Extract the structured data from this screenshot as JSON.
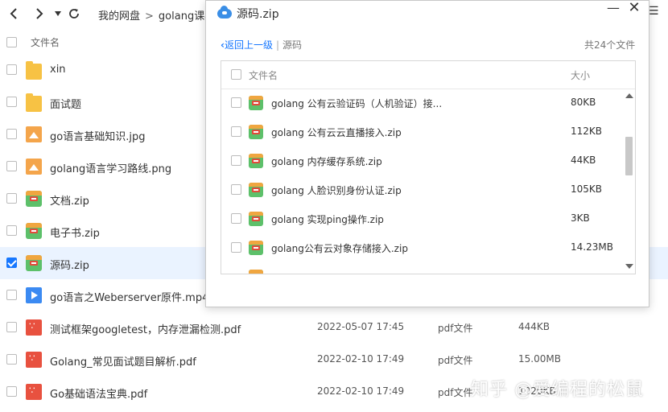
{
  "nav": {
    "back_icon": "chevron-left-icon",
    "forward_icon": "chevron-right-icon",
    "dropdown_icon": "triangle-down-icon",
    "refresh_icon": "refresh-icon",
    "breadcrumbs": [
      "我的网盘",
      "golang课程"
    ]
  },
  "list": {
    "header_name": "文件名",
    "rows": [
      {
        "name": "xin",
        "icon": "folder-icon",
        "date": "",
        "type": "",
        "size": "",
        "checked": false
      },
      {
        "name": "面试题",
        "icon": "folder-icon",
        "date": "",
        "type": "",
        "size": "",
        "checked": false
      },
      {
        "name": "go语言基础知识.jpg",
        "icon": "image-icon",
        "date": "",
        "type": "",
        "size": "",
        "checked": false
      },
      {
        "name": "golang语言学习路线.png",
        "icon": "image-icon",
        "date": "",
        "type": "",
        "size": "",
        "checked": false
      },
      {
        "name": "文档.zip",
        "icon": "zip-icon",
        "date": "",
        "type": "",
        "size": "",
        "checked": false
      },
      {
        "name": "电子书.zip",
        "icon": "zip-icon",
        "date": "",
        "type": "",
        "size": "",
        "checked": false
      },
      {
        "name": "源码.zip",
        "icon": "zip-icon",
        "date": "",
        "type": "",
        "size": "",
        "checked": true
      },
      {
        "name": "go语言之Weberserver原件.mp4",
        "icon": "video-icon",
        "date": "",
        "type": "",
        "size": "",
        "checked": false
      },
      {
        "name": "测试框架googletest，内存泄漏检测.pdf",
        "icon": "pdf-icon",
        "date": "2022-05-07 17:45",
        "type": "pdf文件",
        "size": "444KB",
        "checked": false
      },
      {
        "name": "Golang_常见面试题目解析.pdf",
        "icon": "pdf-icon",
        "date": "2022-02-10 17:49",
        "type": "pdf文件",
        "size": "15.00MB",
        "checked": false
      },
      {
        "name": "Go基础语法宝典.pdf",
        "icon": "pdf-icon",
        "date": "2022-02-10 17:49",
        "type": "pdf文件",
        "size": "1020KB",
        "checked": false
      }
    ]
  },
  "dialog": {
    "title": "源码.zip",
    "back_label": "返回上一级",
    "current_folder": "源码",
    "count_label": "共24个文件",
    "header_name": "文件名",
    "header_size": "大小",
    "files": [
      {
        "name": "golang 公有云验证码（人机验证）接...",
        "size": "80KB"
      },
      {
        "name": "golang 公有云云直播接入.zip",
        "size": "112KB"
      },
      {
        "name": "golang 内存缓存系统.zip",
        "size": "44KB"
      },
      {
        "name": "golang 人脸识别身份认证.zip",
        "size": "105KB"
      },
      {
        "name": "golang 实现ping操作.zip",
        "size": "3KB"
      },
      {
        "name": "golang公有云对象存储接入.zip",
        "size": "14.23MB"
      }
    ]
  },
  "watermark": "知乎 @爱编程的松鼠",
  "colors": {
    "accent": "#1677ff",
    "selected_row": "#eaf3ff"
  }
}
